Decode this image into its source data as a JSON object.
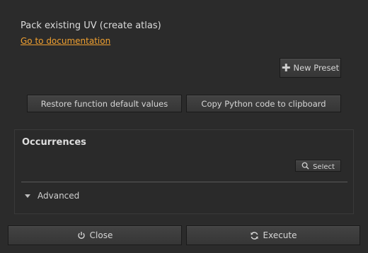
{
  "header": {
    "title": "Pack existing UV (create atlas)",
    "doc_link": "Go to documentation"
  },
  "presets": {
    "new_preset_label": "New Preset"
  },
  "actions": {
    "restore_label": "Restore function default values",
    "copy_label": "Copy Python code to clipboard"
  },
  "occurrences": {
    "title": "Occurrences",
    "select_label": "Select",
    "advanced_label": "Advanced"
  },
  "footer": {
    "close_label": "Close",
    "execute_label": "Execute"
  },
  "icons": {
    "new_preset": "plus-icon",
    "select": "search-icon",
    "advanced": "triangle-down-icon",
    "close": "power-icon",
    "execute": "refresh-icon"
  },
  "colors": {
    "background": "#2b2b2b",
    "link": "#f0a030",
    "button": "#3c3c3c",
    "text": "#d6d6d6"
  }
}
